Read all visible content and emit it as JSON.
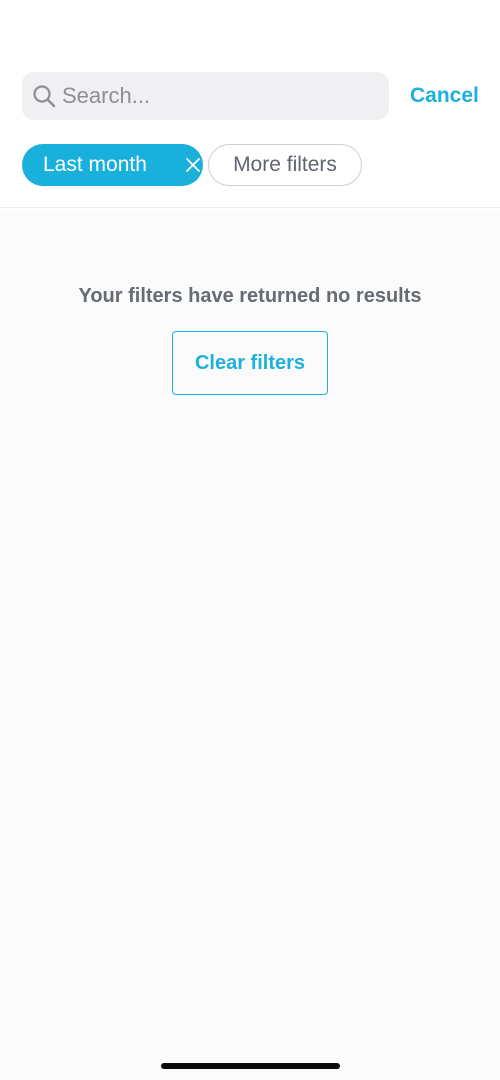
{
  "search": {
    "placeholder": "Search...",
    "icon": "search-icon"
  },
  "cancel_label": "Cancel",
  "filters": {
    "active_chip": {
      "label": "Last month",
      "icon": "close-icon"
    },
    "more_filters_label": "More filters"
  },
  "empty_state": {
    "message": "Your filters have returned no results",
    "clear_button_label": "Clear filters"
  },
  "colors": {
    "accent": "#1eb0dd",
    "chip_active_bg": "#1ab0dc",
    "search_bg": "#f0f0f2",
    "muted_text": "#656c74",
    "page_bg": "#fcfbfc"
  }
}
